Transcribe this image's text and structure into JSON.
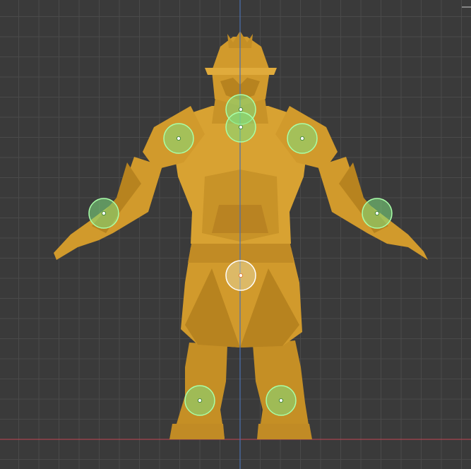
{
  "viewport": {
    "background": "#3a3a3a",
    "grid_color": "#4a4a4a",
    "axis_x_color": "#a8454f",
    "axis_z_color": "#4a6fb0"
  },
  "character": {
    "body_color": "#d19a2c",
    "shadow_color": "#a8771a",
    "highlight_color": "#e0ab3c"
  },
  "rig_markers": {
    "fill_color": "#7fe07f",
    "ring_color": "#a8ffa8",
    "selected_fill": "#e8e0b0",
    "selected_ring": "#ffffff",
    "items": [
      {
        "name": "neck-marker",
        "selected": false
      },
      {
        "name": "chest-marker",
        "selected": false
      },
      {
        "name": "shoulder-right-marker",
        "selected": false
      },
      {
        "name": "shoulder-left-marker",
        "selected": false
      },
      {
        "name": "wrist-right-marker",
        "selected": false
      },
      {
        "name": "wrist-left-marker",
        "selected": false
      },
      {
        "name": "hips-marker",
        "selected": true
      },
      {
        "name": "ankle-right-marker",
        "selected": false
      },
      {
        "name": "ankle-left-marker",
        "selected": false
      }
    ]
  }
}
